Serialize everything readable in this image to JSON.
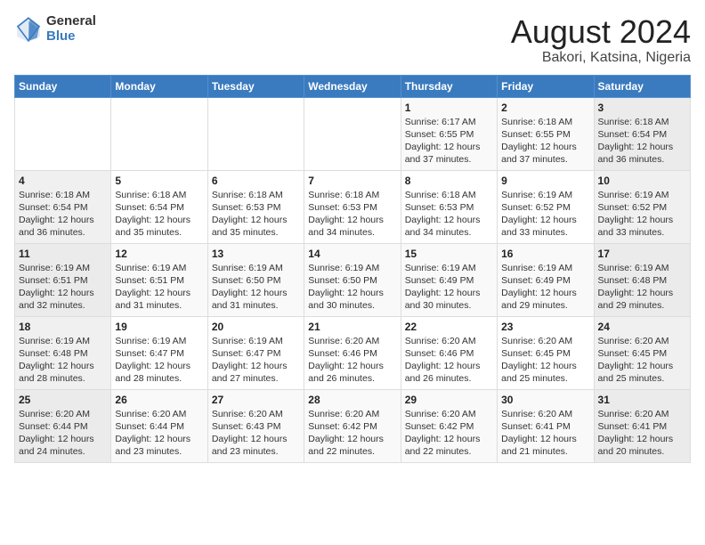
{
  "header": {
    "logo_general": "General",
    "logo_blue": "Blue",
    "month_title": "August 2024",
    "location": "Bakori, Katsina, Nigeria"
  },
  "calendar": {
    "days_of_week": [
      "Sunday",
      "Monday",
      "Tuesday",
      "Wednesday",
      "Thursday",
      "Friday",
      "Saturday"
    ],
    "weeks": [
      [
        {
          "day": "",
          "info": ""
        },
        {
          "day": "",
          "info": ""
        },
        {
          "day": "",
          "info": ""
        },
        {
          "day": "",
          "info": ""
        },
        {
          "day": "1",
          "info": "Sunrise: 6:17 AM\nSunset: 6:55 PM\nDaylight: 12 hours\nand 37 minutes."
        },
        {
          "day": "2",
          "info": "Sunrise: 6:18 AM\nSunset: 6:55 PM\nDaylight: 12 hours\nand 37 minutes."
        },
        {
          "day": "3",
          "info": "Sunrise: 6:18 AM\nSunset: 6:54 PM\nDaylight: 12 hours\nand 36 minutes."
        }
      ],
      [
        {
          "day": "4",
          "info": "Sunrise: 6:18 AM\nSunset: 6:54 PM\nDaylight: 12 hours\nand 36 minutes."
        },
        {
          "day": "5",
          "info": "Sunrise: 6:18 AM\nSunset: 6:54 PM\nDaylight: 12 hours\nand 35 minutes."
        },
        {
          "day": "6",
          "info": "Sunrise: 6:18 AM\nSunset: 6:53 PM\nDaylight: 12 hours\nand 35 minutes."
        },
        {
          "day": "7",
          "info": "Sunrise: 6:18 AM\nSunset: 6:53 PM\nDaylight: 12 hours\nand 34 minutes."
        },
        {
          "day": "8",
          "info": "Sunrise: 6:18 AM\nSunset: 6:53 PM\nDaylight: 12 hours\nand 34 minutes."
        },
        {
          "day": "9",
          "info": "Sunrise: 6:19 AM\nSunset: 6:52 PM\nDaylight: 12 hours\nand 33 minutes."
        },
        {
          "day": "10",
          "info": "Sunrise: 6:19 AM\nSunset: 6:52 PM\nDaylight: 12 hours\nand 33 minutes."
        }
      ],
      [
        {
          "day": "11",
          "info": "Sunrise: 6:19 AM\nSunset: 6:51 PM\nDaylight: 12 hours\nand 32 minutes."
        },
        {
          "day": "12",
          "info": "Sunrise: 6:19 AM\nSunset: 6:51 PM\nDaylight: 12 hours\nand 31 minutes."
        },
        {
          "day": "13",
          "info": "Sunrise: 6:19 AM\nSunset: 6:50 PM\nDaylight: 12 hours\nand 31 minutes."
        },
        {
          "day": "14",
          "info": "Sunrise: 6:19 AM\nSunset: 6:50 PM\nDaylight: 12 hours\nand 30 minutes."
        },
        {
          "day": "15",
          "info": "Sunrise: 6:19 AM\nSunset: 6:49 PM\nDaylight: 12 hours\nand 30 minutes."
        },
        {
          "day": "16",
          "info": "Sunrise: 6:19 AM\nSunset: 6:49 PM\nDaylight: 12 hours\nand 29 minutes."
        },
        {
          "day": "17",
          "info": "Sunrise: 6:19 AM\nSunset: 6:48 PM\nDaylight: 12 hours\nand 29 minutes."
        }
      ],
      [
        {
          "day": "18",
          "info": "Sunrise: 6:19 AM\nSunset: 6:48 PM\nDaylight: 12 hours\nand 28 minutes."
        },
        {
          "day": "19",
          "info": "Sunrise: 6:19 AM\nSunset: 6:47 PM\nDaylight: 12 hours\nand 28 minutes."
        },
        {
          "day": "20",
          "info": "Sunrise: 6:19 AM\nSunset: 6:47 PM\nDaylight: 12 hours\nand 27 minutes."
        },
        {
          "day": "21",
          "info": "Sunrise: 6:20 AM\nSunset: 6:46 PM\nDaylight: 12 hours\nand 26 minutes."
        },
        {
          "day": "22",
          "info": "Sunrise: 6:20 AM\nSunset: 6:46 PM\nDaylight: 12 hours\nand 26 minutes."
        },
        {
          "day": "23",
          "info": "Sunrise: 6:20 AM\nSunset: 6:45 PM\nDaylight: 12 hours\nand 25 minutes."
        },
        {
          "day": "24",
          "info": "Sunrise: 6:20 AM\nSunset: 6:45 PM\nDaylight: 12 hours\nand 25 minutes."
        }
      ],
      [
        {
          "day": "25",
          "info": "Sunrise: 6:20 AM\nSunset: 6:44 PM\nDaylight: 12 hours\nand 24 minutes."
        },
        {
          "day": "26",
          "info": "Sunrise: 6:20 AM\nSunset: 6:44 PM\nDaylight: 12 hours\nand 23 minutes."
        },
        {
          "day": "27",
          "info": "Sunrise: 6:20 AM\nSunset: 6:43 PM\nDaylight: 12 hours\nand 23 minutes."
        },
        {
          "day": "28",
          "info": "Sunrise: 6:20 AM\nSunset: 6:42 PM\nDaylight: 12 hours\nand 22 minutes."
        },
        {
          "day": "29",
          "info": "Sunrise: 6:20 AM\nSunset: 6:42 PM\nDaylight: 12 hours\nand 22 minutes."
        },
        {
          "day": "30",
          "info": "Sunrise: 6:20 AM\nSunset: 6:41 PM\nDaylight: 12 hours\nand 21 minutes."
        },
        {
          "day": "31",
          "info": "Sunrise: 6:20 AM\nSunset: 6:41 PM\nDaylight: 12 hours\nand 20 minutes."
        }
      ]
    ]
  }
}
